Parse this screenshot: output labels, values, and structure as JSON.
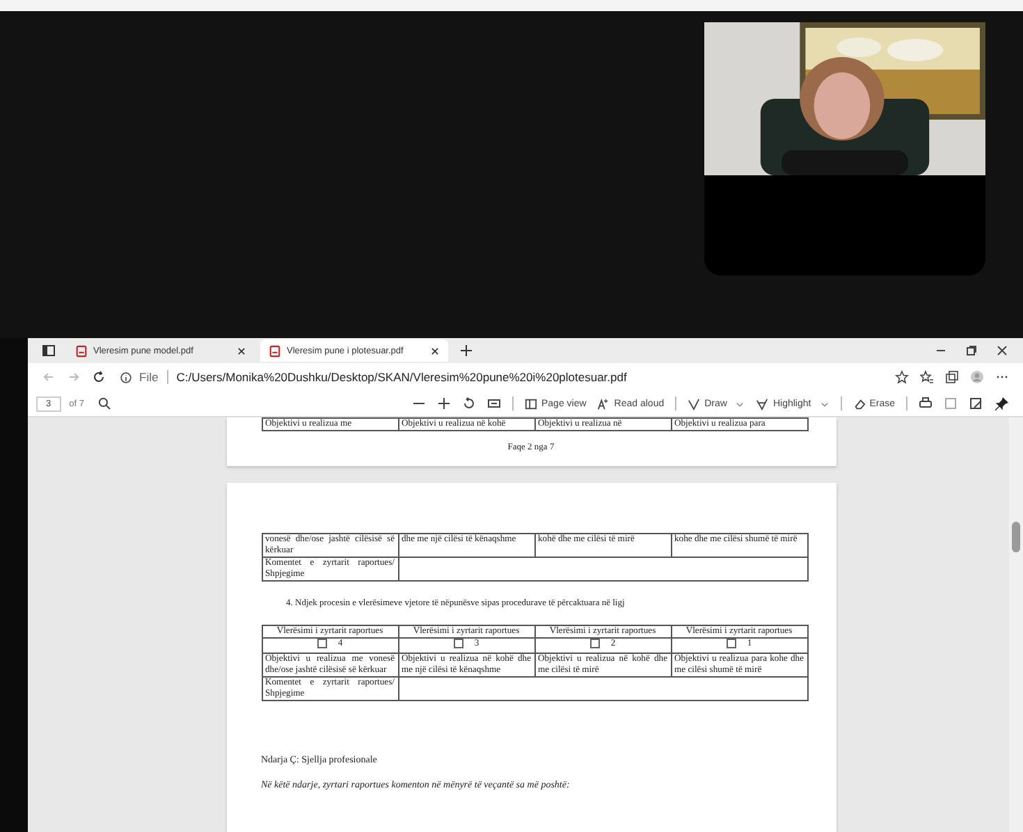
{
  "tabs": [
    {
      "title": "Vleresim pune model.pdf",
      "selected": false
    },
    {
      "title": "Vleresim pune i plotesuar.pdf",
      "selected": true
    }
  ],
  "address": {
    "info": "File",
    "url": "C:/Users/Monika%20Dushku/Desktop/SKAN/Vleresim%20pune%20i%20plotesuar.pdf"
  },
  "pdf_toolbar": {
    "page": "3",
    "page_count": "of 7",
    "tools": [
      "Page view",
      "Read aloud",
      "Draw",
      "Highlight",
      "Erase"
    ]
  },
  "document": {
    "cut_row": [
      "Objektivi u realizua me",
      "Objektivi u realizua në kohë",
      "Objektivi u realizua në",
      "Objektivi u realizua para"
    ],
    "page_footer": "Faqe 2 nga 7",
    "table_1": [
      [
        "vonesë dhe/ose jashtë cilësisë së kërkuar",
        "dhe me një cilësi të kënaqshme",
        "kohë dhe me cilësi të mirë",
        "kohe dhe me cilësi shumë të mirë"
      ],
      [
        "Komentet e zyrtarit raportues/ Shpjegime"
      ]
    ],
    "list_item": "4. Ndjek procesin e vlerësimeve vjetore të nëpunësve  sipas procedurave të përcaktuara në ligj",
    "table_2": {
      "headers": [
        "Vlerësimi i zyrtarit raportues",
        "Vlerësimi i zyrtarit raportues",
        "Vlerësimi i zyrtarit raportues",
        "Vlerësimi i zyrtarit raportues"
      ],
      "options": [
        {
          "label": "4",
          "checked": false
        },
        {
          "label": "3",
          "checked": false
        },
        {
          "label": "2",
          "checked": false
        },
        {
          "label": "1",
          "checked": false
        }
      ],
      "rows": [
        [
          "Objektivi u realizua me vonesë dhe/ose jashtë cilësisë së kërkuar",
          "Objektivi u realizua në kohë dhe me një cilësi të kënaqshme",
          "Objektivi u realizua në kohë dhe me cilësi të mirë",
          "Objektivi u realizua para kohe dhe me cilësi shumë të mirë"
        ],
        [
          "Komentet e zyrtarit raportues/ Shpjegime"
        ]
      ]
    },
    "section_title": "Ndarja Ç: Sjellja profesionale",
    "note": "Në këtë ndarje, zyrtari raportues komenton në mënyrë të veçantë sa më poshtë:"
  }
}
